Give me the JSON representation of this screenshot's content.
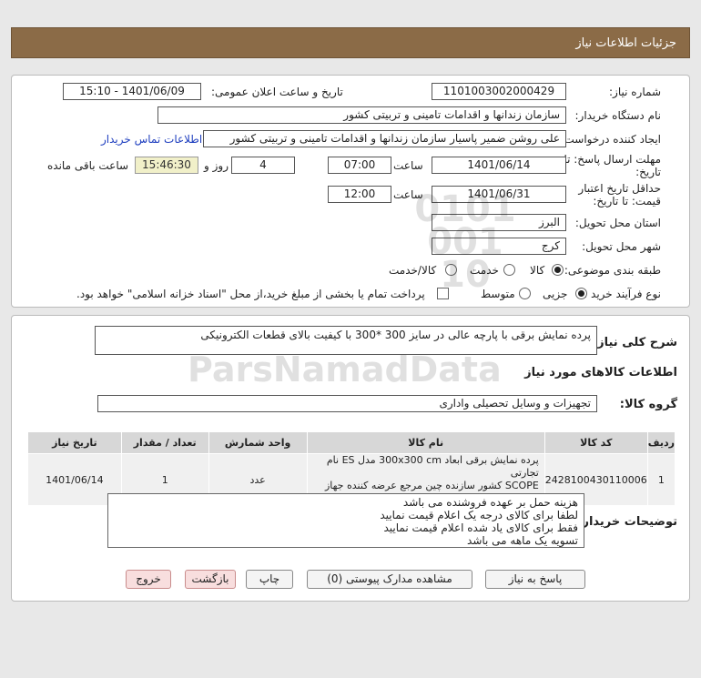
{
  "header": {
    "title": "جزئیات اطلاعات نیاز"
  },
  "form": {
    "need_number_label": "شماره نیاز:",
    "need_number": "1101003002000429",
    "announce_label": "تاریخ و ساعت اعلان عمومی:",
    "announce_value": "1401/06/09 - 15:10",
    "buyer_org_label": "نام دستگاه خریدار:",
    "buyer_org": "سازمان زندانها و اقدامات تامینی و تربیتی کشور",
    "creator_label": "ایجاد کننده درخواست:",
    "creator": "علی روشن ضمیر پاسیار سازمان زندانها و اقدامات تامینی و تربیتی کشور",
    "contact_link": "اطلاعات تماس خریدار",
    "deadline_label_1": "مهلت ارسال پاسخ: تا",
    "deadline_label_2": "تاریخ:",
    "deadline_date": "1401/06/14",
    "time_label": "ساعت",
    "deadline_time": "07:00",
    "days_value": "4",
    "days_label": "روز و",
    "remaining_time": "15:46:30",
    "remaining_label": "ساعت باقی مانده",
    "validity_label_1": "حداقل تاریخ اعتبار",
    "validity_label_2": "قیمت: تا تاریخ:",
    "validity_date": "1401/06/31",
    "validity_time_label": "ساعت",
    "validity_time": "12:00",
    "province_label": "استان محل تحویل:",
    "province": "البرز",
    "city_label": "شهر محل تحویل:",
    "city": "کرج",
    "category_label": "طبقه بندی موضوعی:",
    "category_options": [
      "کالا",
      "خدمت",
      "کالا/خدمت"
    ],
    "process_label": "نوع فرآیند خرید :",
    "process_options": [
      "جزیی",
      "متوسط"
    ],
    "payment_note": "پرداخت تمام یا بخشی از مبلغ خرید،از محل \"اسناد خزانه اسلامی\" خواهد بود."
  },
  "summary": {
    "label": "شرح کلی نیاز:",
    "text": "پرده نمایش برقی با پارچه عالی در سایز 300 *300 با کیفیت بالای قطعات الکترونیکی",
    "goods_info_title": "اطلاعات کالاهای مورد نیاز",
    "group_label": "گروه کالا:",
    "group_value": "تجهیزات و وسایل تحصیلی واداری"
  },
  "table": {
    "headers": [
      "ردیف",
      "کد کالا",
      "نام کالا",
      "واحد شمارش",
      "تعداد / مقدار",
      "تاریخ نیاز"
    ],
    "rows": [
      {
        "index": "1",
        "code": "2428100430110006",
        "name_line1": "پرده نمایش برقی ابعاد 300x300 cm مدل ES نام تجارتی",
        "name_line2": "SCOPE کشور سازنده چین مرجع عرضه کننده جهاز دارایی",
        "unit": "عدد",
        "qty": "1",
        "date": "1401/06/14"
      }
    ]
  },
  "buyer_notes": {
    "label": "توضیحات خریدار:",
    "lines": [
      "هزینه حمل بر عهده فروشنده می باشد",
      "لطفا برای کالای درجه یک اعلام قیمت نمایید",
      "فقط برای کالای یاد شده اعلام قیمت نمایید",
      "تسویه یک ماهه می باشد"
    ]
  },
  "buttons": {
    "reply": "پاسخ به نیاز",
    "view_docs": "مشاهده مدارک پیوستی (0)",
    "print": "چاپ",
    "back": "بازگشت",
    "exit": "خروج"
  },
  "watermark": {
    "brand": "ParsNamadData",
    "numbers": "0101 001 10"
  }
}
